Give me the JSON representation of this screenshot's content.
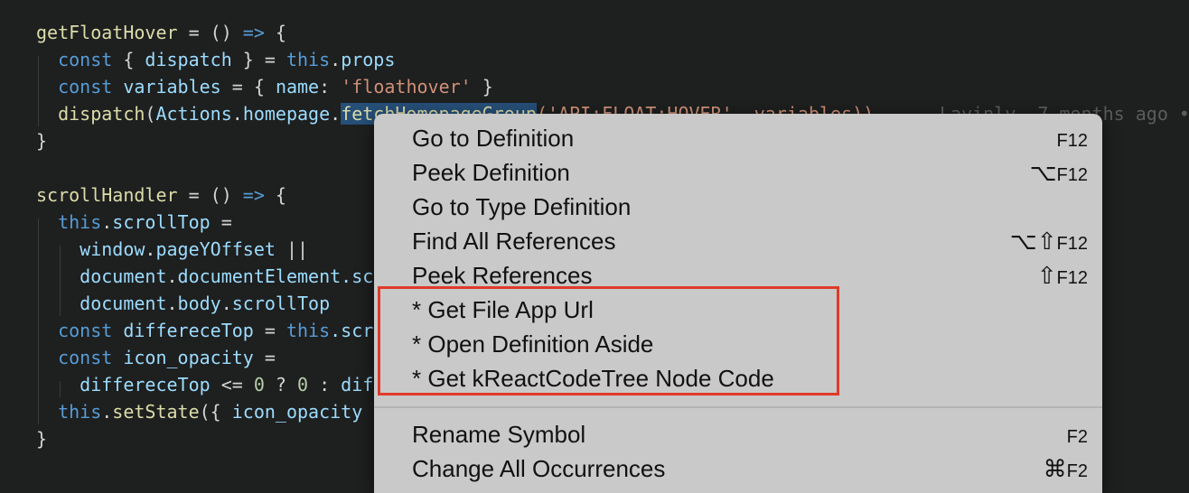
{
  "code": {
    "lines": [
      {
        "tokens": [
          {
            "t": "getFloatHover",
            "c": "fn"
          },
          {
            "t": " = () ",
            "c": "op"
          },
          {
            "t": "=>",
            "c": "kw"
          },
          {
            "t": " {",
            "c": "op"
          }
        ]
      },
      {
        "tokens": [
          {
            "t": "  const",
            "c": "kw"
          },
          {
            "t": " { ",
            "c": "op"
          },
          {
            "t": "dispatch",
            "c": "var"
          },
          {
            "t": " } = ",
            "c": "op"
          },
          {
            "t": "this",
            "c": "kw"
          },
          {
            "t": ".",
            "c": "op"
          },
          {
            "t": "props",
            "c": "var"
          }
        ]
      },
      {
        "tokens": [
          {
            "t": "  const",
            "c": "kw"
          },
          {
            "t": " ",
            "c": "op"
          },
          {
            "t": "variables",
            "c": "var"
          },
          {
            "t": " = { ",
            "c": "op"
          },
          {
            "t": "name",
            "c": "var"
          },
          {
            "t": ": ",
            "c": "op"
          },
          {
            "t": "'floathover'",
            "c": "str"
          },
          {
            "t": " }",
            "c": "op"
          }
        ]
      },
      {
        "tokens": [
          {
            "t": "  ",
            "c": "op"
          },
          {
            "t": "dispatch",
            "c": "fn"
          },
          {
            "t": "(",
            "c": "op"
          },
          {
            "t": "Actions",
            "c": "var"
          },
          {
            "t": ".",
            "c": "op"
          },
          {
            "t": "homepage",
            "c": "var"
          },
          {
            "t": ".",
            "c": "op"
          },
          {
            "t": "fetchHomepageGroup",
            "c": "sel"
          },
          {
            "t": "('API:FLOAT:HOVER', variables))",
            "c": "str"
          }
        ]
      },
      {
        "tokens": [
          {
            "t": "}",
            "c": "op"
          }
        ]
      },
      {
        "tokens": []
      },
      {
        "tokens": [
          {
            "t": "scrollHandler",
            "c": "fn"
          },
          {
            "t": " = () ",
            "c": "op"
          },
          {
            "t": "=>",
            "c": "kw"
          },
          {
            "t": " {",
            "c": "op"
          }
        ]
      },
      {
        "tokens": [
          {
            "t": "  this",
            "c": "kw"
          },
          {
            "t": ".",
            "c": "op"
          },
          {
            "t": "scrollTop",
            "c": "var"
          },
          {
            "t": " =",
            "c": "op"
          }
        ]
      },
      {
        "tokens": [
          {
            "t": "    window",
            "c": "var"
          },
          {
            "t": ".",
            "c": "op"
          },
          {
            "t": "pageYOffset",
            "c": "var"
          },
          {
            "t": " ||",
            "c": "op"
          }
        ]
      },
      {
        "tokens": [
          {
            "t": "    document",
            "c": "var"
          },
          {
            "t": ".",
            "c": "op"
          },
          {
            "t": "documentElement",
            "c": "var"
          },
          {
            "t": ".sc",
            "c": "var"
          }
        ]
      },
      {
        "tokens": [
          {
            "t": "    document",
            "c": "var"
          },
          {
            "t": ".",
            "c": "op"
          },
          {
            "t": "body",
            "c": "var"
          },
          {
            "t": ".",
            "c": "op"
          },
          {
            "t": "scrollTop",
            "c": "var"
          }
        ]
      },
      {
        "tokens": [
          {
            "t": "  const",
            "c": "kw"
          },
          {
            "t": " ",
            "c": "op"
          },
          {
            "t": "differeceTop",
            "c": "var"
          },
          {
            "t": " = ",
            "c": "op"
          },
          {
            "t": "this",
            "c": "kw"
          },
          {
            "t": ".scr",
            "c": "var"
          }
        ]
      },
      {
        "tokens": [
          {
            "t": "  const",
            "c": "kw"
          },
          {
            "t": " ",
            "c": "op"
          },
          {
            "t": "icon_opacity",
            "c": "var"
          },
          {
            "t": " =",
            "c": "op"
          }
        ]
      },
      {
        "tokens": [
          {
            "t": "    differeceTop",
            "c": "var"
          },
          {
            "t": " <= ",
            "c": "op"
          },
          {
            "t": "0",
            "c": "num"
          },
          {
            "t": " ? ",
            "c": "op"
          },
          {
            "t": "0",
            "c": "num"
          },
          {
            "t": " : ",
            "c": "op"
          },
          {
            "t": "dif",
            "c": "var"
          }
        ]
      },
      {
        "tokens": [
          {
            "t": "  this",
            "c": "kw"
          },
          {
            "t": ".",
            "c": "op"
          },
          {
            "t": "setState",
            "c": "fn"
          },
          {
            "t": "({ ",
            "c": "op"
          },
          {
            "t": "icon_opacity",
            "c": "var"
          }
        ]
      },
      {
        "tokens": [
          {
            "t": "}",
            "c": "op"
          }
        ]
      }
    ],
    "blame": "Lavinly, 7 months ago •"
  },
  "context_menu": {
    "items": [
      {
        "label": "Go to Definition",
        "shortcut_sym": "",
        "shortcut_key": "F12"
      },
      {
        "label": "Peek Definition",
        "shortcut_sym": "⌥",
        "shortcut_key": "F12"
      },
      {
        "label": "Go to Type Definition",
        "shortcut_sym": "",
        "shortcut_key": ""
      },
      {
        "label": "Find All References",
        "shortcut_sym": "⌥⇧",
        "shortcut_key": "F12"
      },
      {
        "label": "Peek References",
        "shortcut_sym": "⇧",
        "shortcut_key": "F12"
      },
      {
        "label": "* Get File App Url",
        "shortcut_sym": "",
        "shortcut_key": ""
      },
      {
        "label": "* Open Definition Aside",
        "shortcut_sym": "",
        "shortcut_key": ""
      },
      {
        "label": "* Get kReactCodeTree Node Code",
        "shortcut_sym": "",
        "shortcut_key": ""
      },
      {
        "label": "Rename Symbol",
        "shortcut_sym": "",
        "shortcut_key": "F2"
      },
      {
        "label": "Change All Occurrences",
        "shortcut_sym": "⌘",
        "shortcut_key": "F2"
      }
    ]
  },
  "colors": {
    "highlight_border": "#e03a2b",
    "menu_background": "#c9c9c9",
    "editor_background": "#1e1f1f"
  }
}
